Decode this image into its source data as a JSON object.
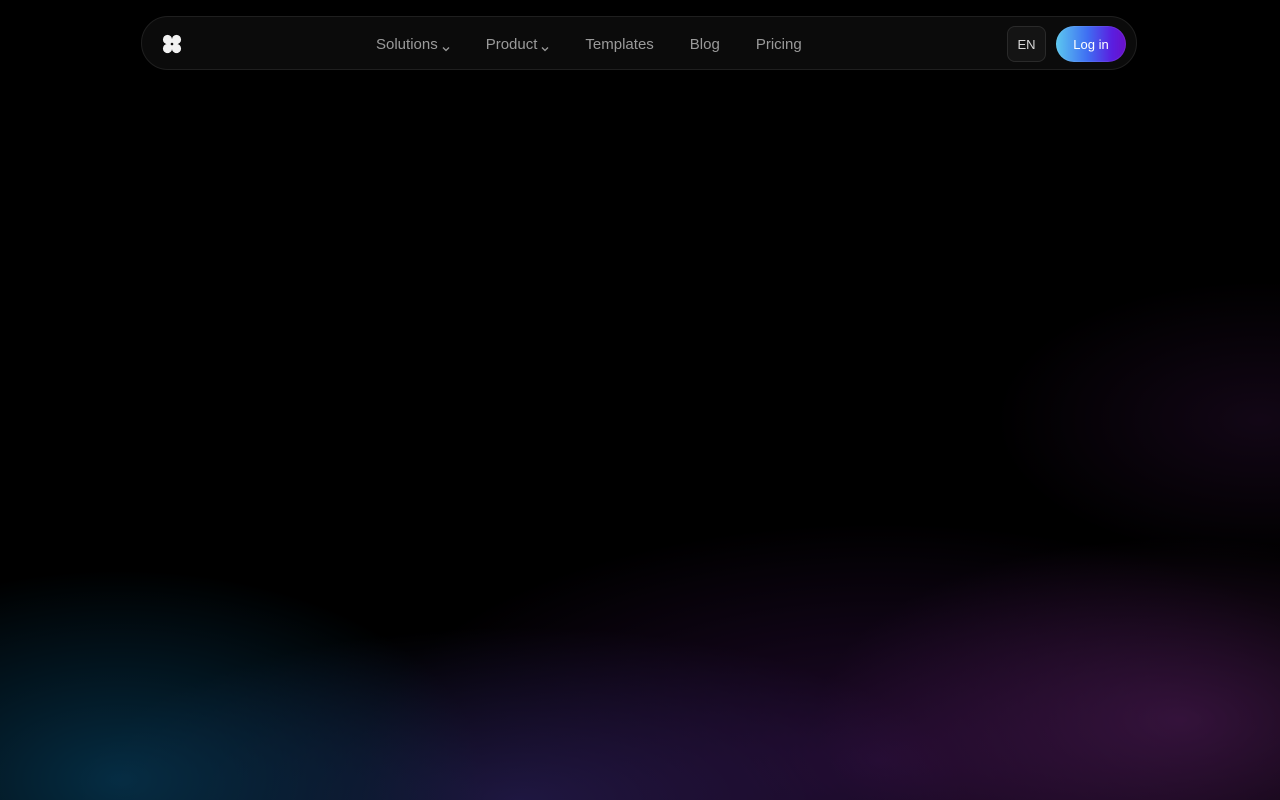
{
  "nav": {
    "links": [
      {
        "label": "Solutions",
        "has_dropdown": true
      },
      {
        "label": "Product",
        "has_dropdown": true
      },
      {
        "label": "Templates",
        "has_dropdown": false
      },
      {
        "label": "Blog",
        "has_dropdown": false
      },
      {
        "label": "Pricing",
        "has_dropdown": false
      }
    ],
    "language": "EN",
    "login_label": "Log in"
  },
  "icons": {
    "logo": "four-petal-logo-icon",
    "dropdown": "chevron-down-icon"
  },
  "colors": {
    "background": "#000000",
    "nav_background": "#0b0b0b",
    "nav_text": "#9a9a9a",
    "login_gradient_start": "#5cc8f0",
    "login_gradient_end": "#6a10c8"
  }
}
